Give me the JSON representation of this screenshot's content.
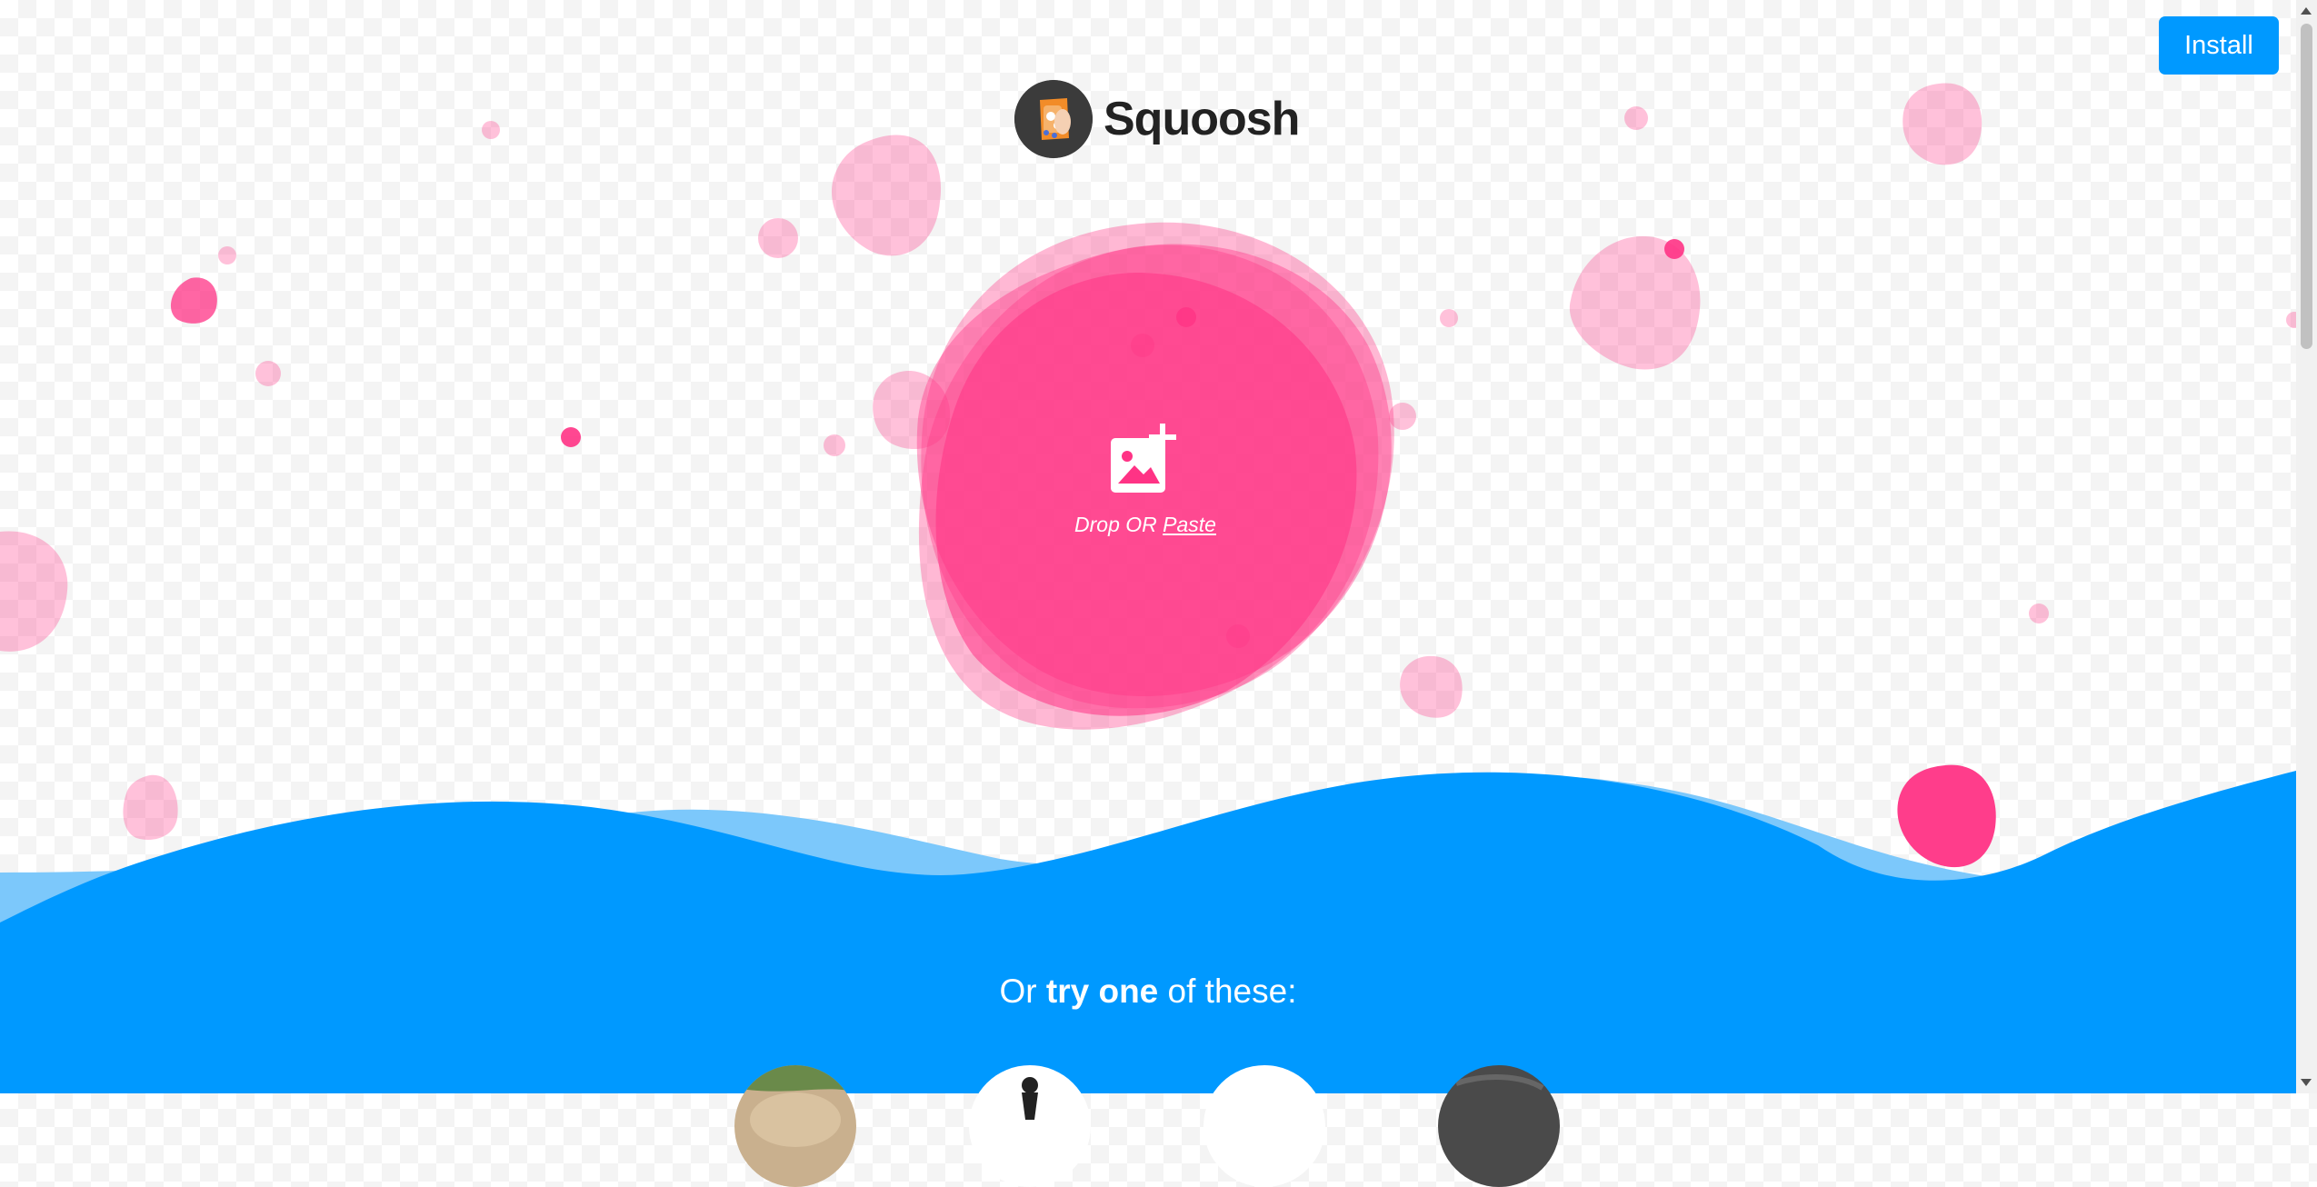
{
  "header": {
    "install_label": "Install",
    "logo_text": "Squoosh"
  },
  "drop_zone": {
    "drop_label": "Drop OR",
    "paste_label": "Paste",
    "icon": "add-image-icon"
  },
  "samples": {
    "prefix": "Or",
    "emphasis": "try one",
    "suffix": "of these:"
  },
  "colors": {
    "accent_blue": "#0099ff",
    "light_blue": "#7cc8fb",
    "brand_pink": "#ff3385"
  }
}
